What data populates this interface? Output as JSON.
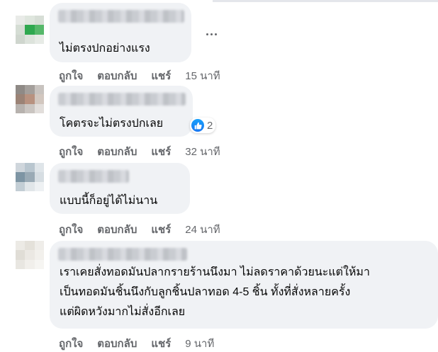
{
  "comments": [
    {
      "text_lines": [
        "ไม่ตรงปกอย่างแรง"
      ],
      "actions": {
        "like": "ถูกใจ",
        "reply": "ตอบกลับ",
        "share": "แชร์",
        "time": "15 นาที"
      },
      "avatar_colors": [
        "#e9ebe8",
        "#dfe6de",
        "#d7ded6",
        "#d5ddd4",
        "#2fa84f",
        "#56b86a",
        "#cfd6ce",
        "#dde3dc",
        "#e7ebe6"
      ]
    },
    {
      "text_lines": [
        "โคตรจะไม่ตรงปกเลย"
      ],
      "reaction": {
        "icon": "like-icon",
        "count": "2",
        "color": "#1877f2"
      },
      "actions": {
        "like": "ถูกใจ",
        "reply": "ตอบกลับ",
        "share": "แชร์",
        "time": "32 นาที"
      },
      "avatar_colors": [
        "#8f8a86",
        "#a49f9b",
        "#c8c3bf",
        "#9b8376",
        "#b89280",
        "#d2c7bf",
        "#b7b2ae",
        "#cac5c1",
        "#e2dedb"
      ]
    },
    {
      "text_lines": [
        "แบบนี้ก็อยู่ได้ไม่นาน"
      ],
      "actions": {
        "like": "ถูกใจ",
        "reply": "ตอบกลับ",
        "share": "แชร์",
        "time": "24 นาที"
      },
      "avatar_colors": [
        "#cfd6dc",
        "#b9c6cf",
        "#dfe5e9",
        "#7e95a4",
        "#9aaab5",
        "#d6dde2",
        "#c3ced5",
        "#e1e6e9",
        "#eef1f3"
      ]
    },
    {
      "text_lines": [
        "เราเคยสั่งทอดมันปลากรายร้านนึงมา ไม่ลดราคาด้วยนะแต่ให้มา",
        "เป็นทอดมันชิ้นนึงกับลูกชิ้นปลาทอด 4-5 ชิ้น ทั้งที่สั่งหลายครั้ง",
        "แต่ผิดหวังมากไม่สั่งอีกเลย"
      ],
      "actions": {
        "like": "ถูกใจ",
        "reply": "ตอบกลับ",
        "share": "แชร์",
        "time": "9 นาที"
      },
      "avatar_colors": [
        "#eceae5",
        "#e4e1da",
        "#efede9",
        "#e0ddd6",
        "#ebe8e3",
        "#f2f0ec",
        "#e8e6e1",
        "#f1efeb",
        "#f6f5f2"
      ]
    }
  ],
  "more_icon": "more-horizontal-icon"
}
